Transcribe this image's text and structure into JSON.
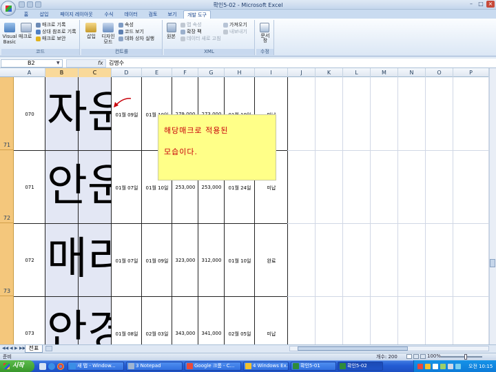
{
  "window": {
    "title": "확인5-02 - Microsoft Excel"
  },
  "ribbon": {
    "tabs": [
      "홈",
      "삽입",
      "페이지 레이아웃",
      "수식",
      "데이터",
      "검토",
      "보기",
      "개발 도구"
    ],
    "active_tab": "개발 도구",
    "groups": {
      "code": {
        "label": "코드",
        "visual_basic": "Visual Basic",
        "macro": "매크로",
        "record_macro": "매크로 기록",
        "relative_ref": "상대 참조로 기록",
        "macro_security": "매크로 보안"
      },
      "controls": {
        "label": "컨트롤",
        "insert": "삽입",
        "design_mode": "디자인 모드",
        "properties": "속성",
        "view_code": "코드 보기",
        "run_dialog": "대화 상자 실행"
      },
      "xml": {
        "label": "XML",
        "source": "원본",
        "map_properties": "맵 속성",
        "expansion_packs": "확장 팩",
        "refresh_data": "데이터 새로 고침",
        "import": "가져오기",
        "export": "내보내기"
      },
      "modify": {
        "label": "수정",
        "document_panel": "문서 창"
      }
    }
  },
  "formula_bar": {
    "name_box": "B2",
    "fx": "fx",
    "value": "김명수"
  },
  "columns": [
    "A",
    "B",
    "C",
    "D",
    "E",
    "F",
    "G",
    "H",
    "I",
    "J",
    "K",
    "L",
    "M",
    "N",
    "O",
    "P"
  ],
  "selected_columns": [
    "B",
    "C"
  ],
  "rows": [
    {
      "num": "71",
      "id": "070",
      "big": "자운",
      "d": "01월 09일",
      "e": "01월 10일",
      "f": "279,000",
      "g": "273,000",
      "h": "01월 10일",
      "i": "미납"
    },
    {
      "num": "72",
      "id": "071",
      "big": "안운",
      "d": "01월 07일",
      "e": "01월 10일",
      "f": "253,000",
      "g": "253,000",
      "h": "01월 24일",
      "i": "미납"
    },
    {
      "num": "73",
      "id": "072",
      "big": "매리",
      "d": "01월 07일",
      "e": "01월 09일",
      "f": "323,000",
      "g": "312,000",
      "h": "01월 10일",
      "i": "완료"
    },
    {
      "num": "",
      "id": "073",
      "big": "안경",
      "d": "01월 08일",
      "e": "02월 03일",
      "f": "343,000",
      "g": "341,000",
      "h": "02월 05일",
      "i": "미납"
    }
  ],
  "note": {
    "line1": "해당매크로 적용된",
    "line2": "모습이다."
  },
  "sheet_tab": "전표",
  "status": {
    "ready": "준비",
    "count": "개수: 200",
    "zoom": "100%"
  },
  "taskbar": {
    "start": "시작",
    "buttons": [
      "새 탭 - Window...",
      "3 Notepad",
      "Google 크롬 - C...",
      "4 Windows Ex...",
      "확인5-01",
      "확인5-02"
    ],
    "active": "확인5-02",
    "clock": "오전 10:15"
  },
  "colors": {
    "note_bg": "#ffff88",
    "note_text": "#c8000a",
    "row_header_selected": "#f4c77c",
    "taskbar": "#245dd4",
    "start": "#38972b"
  }
}
